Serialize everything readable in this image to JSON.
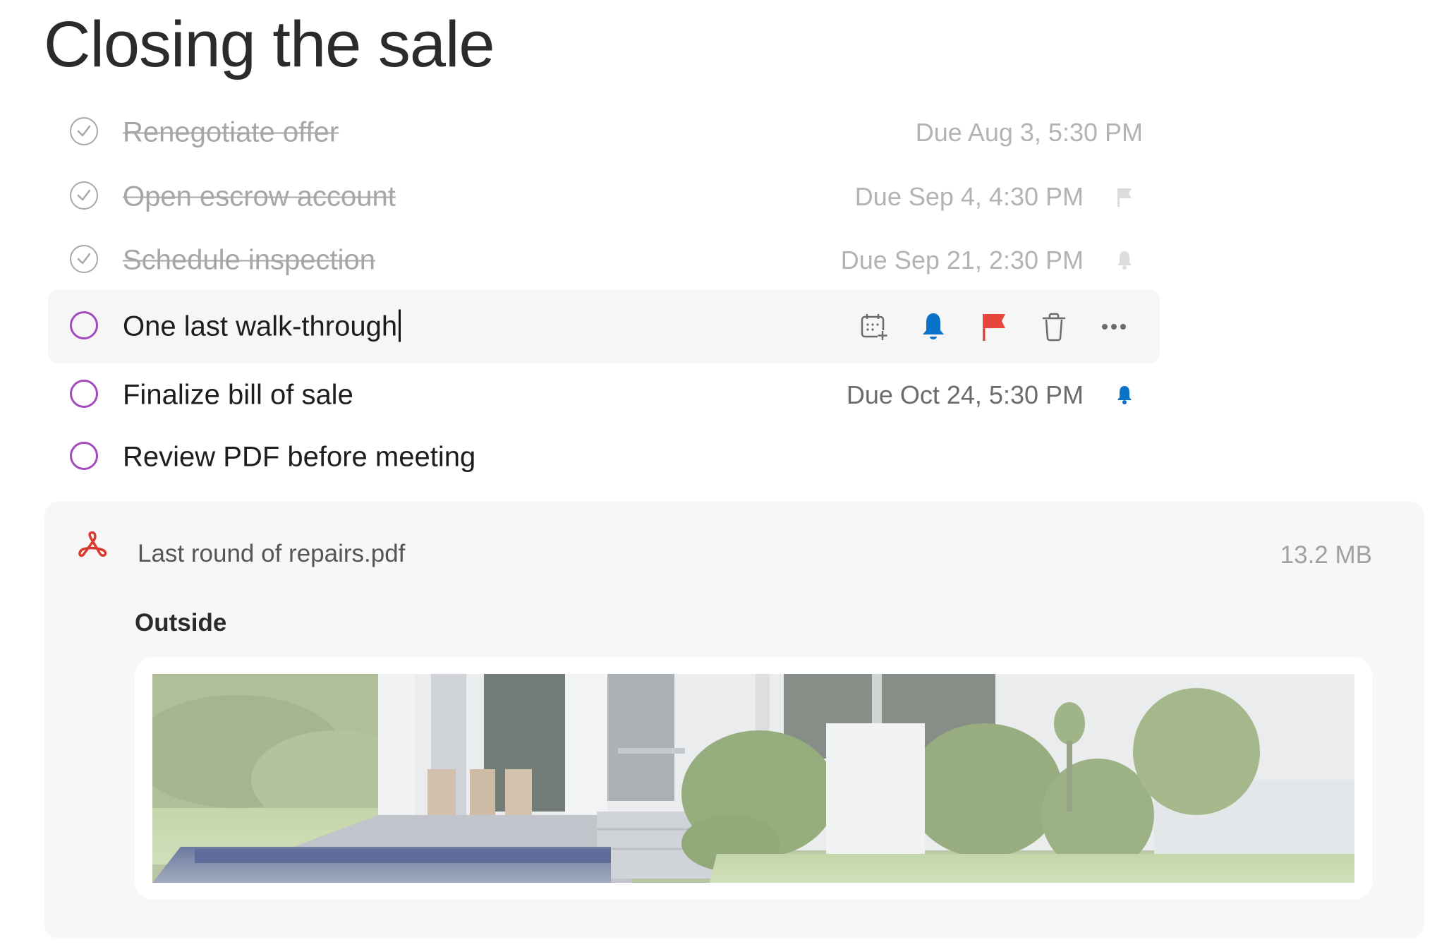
{
  "page": {
    "title": "Closing the sale"
  },
  "colors": {
    "accent_purple": "#a24bbf",
    "bell_blue": "#0a72c9",
    "flag_red": "#e8453c",
    "pdf_red": "#d9392f",
    "completed_gray": "#a6a6a6"
  },
  "tasks": [
    {
      "title": "Renegotiate offer",
      "completed": true,
      "due": "Due Aug 3, 5:30 PM",
      "indicator": null
    },
    {
      "title": "Open escrow account",
      "completed": true,
      "due": "Due Sep 4, 4:30 PM",
      "indicator": "flag-icon"
    },
    {
      "title": "Schedule inspection",
      "completed": true,
      "due": "Due Sep 21, 2:30 PM",
      "indicator": "bell-icon"
    },
    {
      "title": "One last walk-through",
      "completed": false,
      "editing": true,
      "due": null,
      "toolbar": [
        "calendar-add-icon",
        "bell-icon",
        "flag-icon",
        "trash-icon",
        "more-icon"
      ]
    },
    {
      "title": "Finalize bill of sale",
      "completed": false,
      "due": "Due Oct 24, 5:30 PM",
      "indicator": "bell-icon"
    },
    {
      "title": "Review PDF before meeting",
      "completed": false,
      "due": null,
      "indicator": null
    }
  ],
  "attachment": {
    "icon": "pdf-icon",
    "name": "Last round of repairs.pdf",
    "size": "13.2 MB",
    "section_label": "Outside",
    "image_alt": "house-exterior-photo"
  }
}
